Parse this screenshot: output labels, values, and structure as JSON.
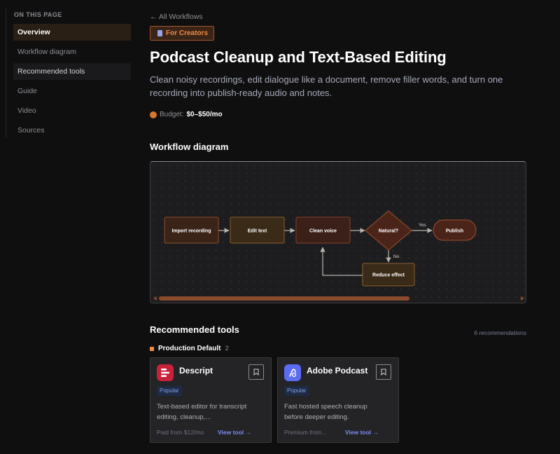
{
  "toc": {
    "heading": "ON THIS PAGE",
    "items": [
      {
        "label": "Overview",
        "state": "active"
      },
      {
        "label": "Workflow diagram",
        "state": "normal"
      },
      {
        "label": "Recommended tools",
        "state": "hover"
      },
      {
        "label": "Guide",
        "state": "normal"
      },
      {
        "label": "Video",
        "state": "normal"
      },
      {
        "label": "Sources",
        "state": "normal"
      }
    ]
  },
  "header": {
    "back_label": "← All Workflows",
    "badge_label": "For Creators",
    "title": "Podcast Cleanup and Text-Based Editing",
    "subtitle": "Clean noisy recordings, edit dialogue like a document, remove filler words, and turn one recording into publish-ready audio and notes.",
    "budget_label": "Budget:",
    "budget_value": "$0–$50/mo"
  },
  "diagram": {
    "title": "Workflow diagram",
    "nodes": {
      "import": "Import recording",
      "edit": "Edit text",
      "clean": "Clean voice",
      "natural": "Natural?",
      "publish": "Publish",
      "reduce": "Reduce effect"
    },
    "edge_labels": {
      "yes": "Yes",
      "no": "No"
    }
  },
  "tools": {
    "title": "Recommended tools",
    "count_label": "6 recommendations",
    "group_name": "Production Default",
    "group_count": "2",
    "cards": [
      {
        "name": "Descript",
        "tag": "Popular",
        "desc": "Text-based editor for transcript editing, cleanup,...",
        "price": "Paid from $12/mo",
        "link": "View tool →"
      },
      {
        "name": "Adobe Podcast",
        "tag": "Popular",
        "desc": "Fast hosted speech cleanup before deeper editing.",
        "price": "Premium from...",
        "link": "View tool →"
      }
    ]
  },
  "colors": {
    "accent": "#f08c45",
    "link": "#7c8cf0",
    "background": "#0f0f10"
  }
}
